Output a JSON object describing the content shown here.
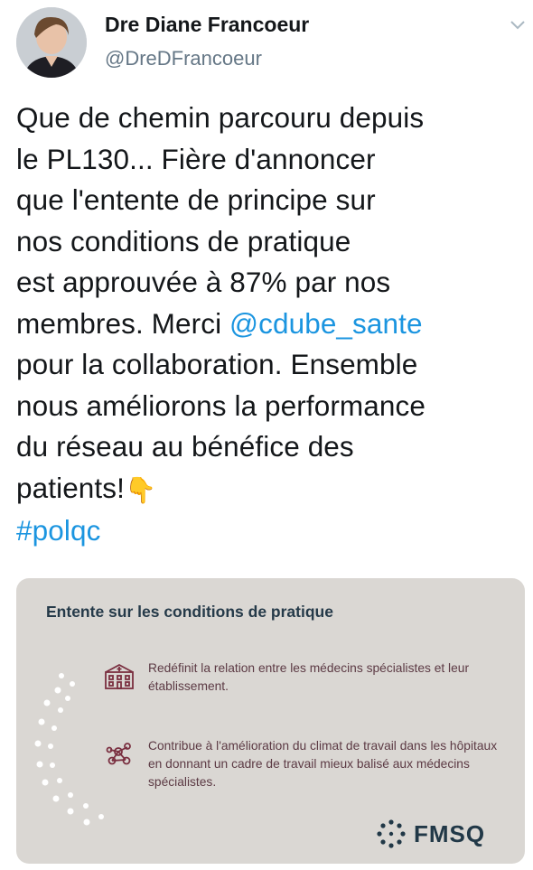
{
  "author": {
    "display_name": "Dre Diane Francoeur",
    "handle": "@DreDFrancoeur",
    "avatar_icon": "person-portrait-icon",
    "menu_icon": "chevron-down-icon"
  },
  "tweet": {
    "lines": [
      "Que de chemin parcouru depuis",
      "le PL130... Fière d'annoncer",
      "que l'entente de principe sur",
      "nos conditions de pratique",
      "est approuvée à 87% par nos"
    ],
    "line6_before": "membres. Merci ",
    "mention": "@cdube_sante",
    "lines_after": [
      "pour la collaboration. Ensemble",
      "nous améliorons la performance",
      "du réseau au bénéfice des"
    ],
    "last_line": "patients!",
    "emoji": "👇",
    "hashtag": "#polqc",
    "link_color": "#1b95e0"
  },
  "card": {
    "title": "Entente sur les conditions de pratique",
    "feature1": "Redéfinit la relation entre les médecins spécialistes et leur établissement.",
    "feature1_icon": "hospital-icon",
    "feature2": "Contribue à l'amélioration du climat de travail dans les hôpitaux en donnant un cadre de travail mieux balisé aux médecins spécialistes.",
    "feature2_icon": "network-icon",
    "logo": "FMSQ",
    "background": "#dad7d3",
    "title_color": "#253a49",
    "accent_color": "#7a2f40"
  }
}
